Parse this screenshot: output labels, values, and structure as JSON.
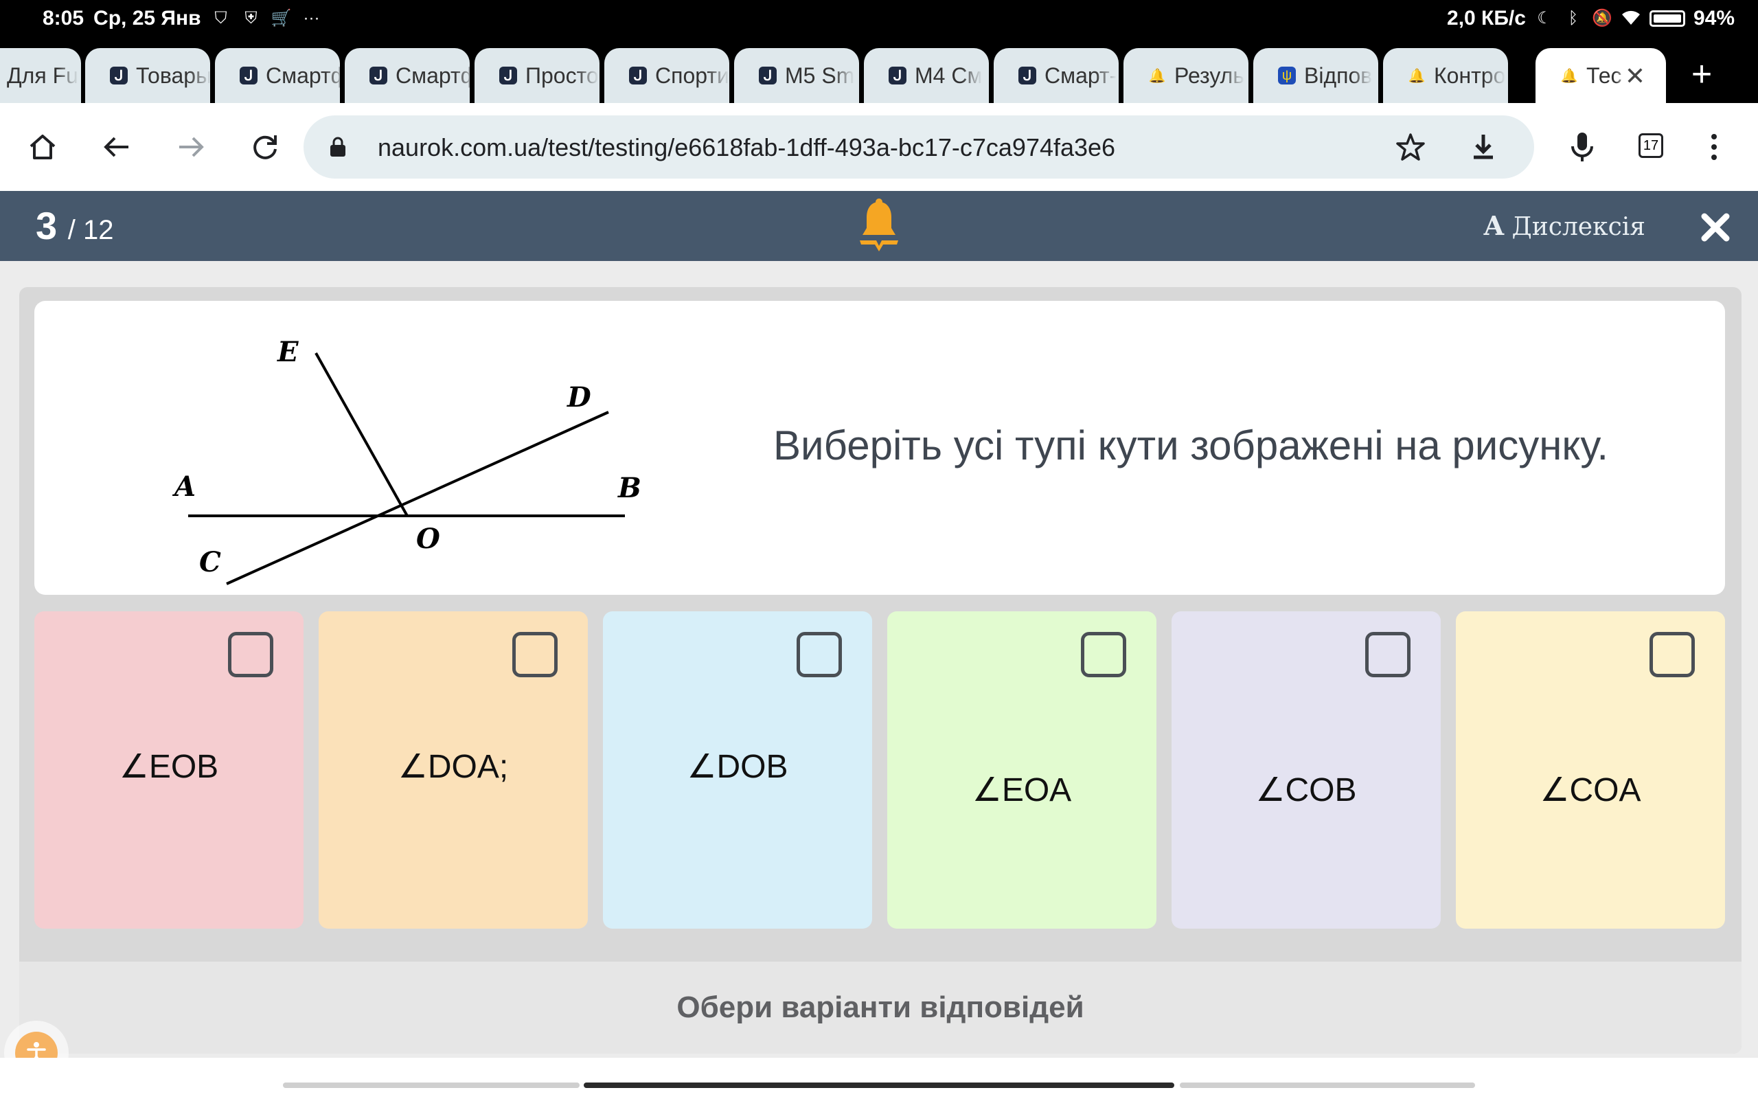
{
  "status": {
    "time": "8:05",
    "date": "Ср, 25 Янв",
    "net_speed": "2,0 КБ/с",
    "battery": "94%"
  },
  "tabs": [
    {
      "label": "Для Fu",
      "favicon": "naurok-n"
    },
    {
      "label": "Товары",
      "favicon": "naurok-n"
    },
    {
      "label": "Смартф",
      "favicon": "naurok-n"
    },
    {
      "label": "Смартф",
      "favicon": "naurok-n"
    },
    {
      "label": "Просто",
      "favicon": "naurok-n"
    },
    {
      "label": "Спорти",
      "favicon": "naurok-n"
    },
    {
      "label": "M5 Sm",
      "favicon": "naurok-n"
    },
    {
      "label": "M4 См",
      "favicon": "naurok-n"
    },
    {
      "label": "Смарт-",
      "favicon": "naurok-n"
    },
    {
      "label": "Резуль",
      "favicon": "bell"
    },
    {
      "label": "Відпов",
      "favicon": "ua-trident"
    },
    {
      "label": "Контро",
      "favicon": "bell"
    },
    {
      "label": "Тес",
      "favicon": "bell",
      "active": true
    }
  ],
  "toolbar": {
    "url": "naurok.com.ua/test/testing/e6618fab-1dff-493a-bc17-c7ca974fa3e6",
    "tab_count": "17"
  },
  "quiz": {
    "current": "3",
    "total": "/ 12",
    "dyslexia_letter": "A",
    "dyslexia_label": "Дислексія",
    "question": "Виберіть усі тупі кути зображені на рисунку.",
    "figure_labels": {
      "E": "E",
      "D": "D",
      "A": "A",
      "B": "B",
      "O": "O",
      "C": "C"
    },
    "options": [
      {
        "label": "∠EOB",
        "color": "#f5cdd0",
        "checked": false
      },
      {
        "label": "∠DOA;",
        "color": "#fbe1b9",
        "checked": false
      },
      {
        "label": "∠DOB",
        "color": "#d7eff9",
        "checked": false
      },
      {
        "label": "∠EOA",
        "color": "#e2fbd0",
        "checked": false
      },
      {
        "label": "∠COB",
        "color": "#e4e3f1",
        "checked": false
      },
      {
        "label": "∠COA",
        "color": "#fdf2cc",
        "checked": false
      }
    ],
    "footer_hint": "Обери варіанти відповідей"
  },
  "colors": {
    "header_bg": "#46586c",
    "bell": "#f5a623"
  }
}
